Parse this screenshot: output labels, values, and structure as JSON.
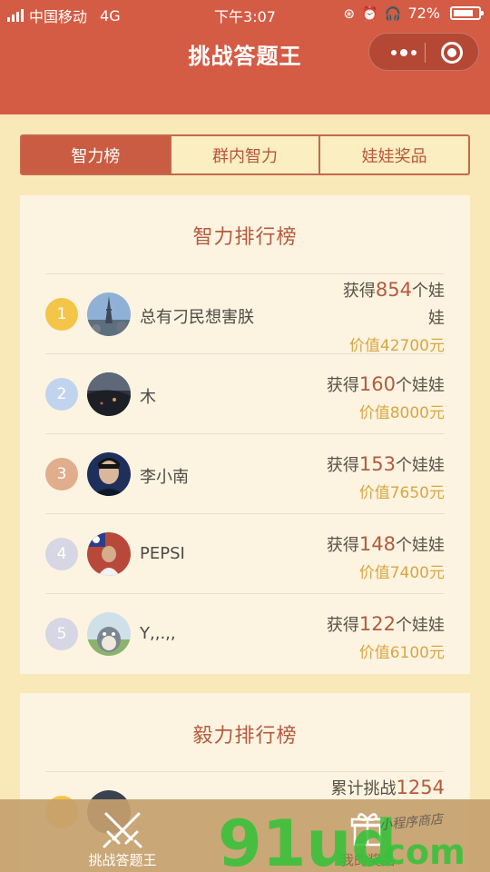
{
  "status_bar": {
    "carrier": "中国移动",
    "network": "4G",
    "time": "下午3:07",
    "battery": "72%"
  },
  "nav": {
    "title": "挑战答题王"
  },
  "tabs": [
    {
      "label": "智力榜",
      "active": true
    },
    {
      "label": "群内智力",
      "active": false
    },
    {
      "label": "娃娃奖品",
      "active": false
    }
  ],
  "leaderboard": {
    "title": "智力排行榜",
    "rows": [
      {
        "rank": "1",
        "name": "总有刁民想害朕",
        "prize_prefix": "获得",
        "count": "854",
        "prize_suffix_line1": "个娃",
        "prize_suffix_line2": "娃",
        "value": "价值42700元",
        "rank_color": "#f3c548"
      },
      {
        "rank": "2",
        "name": "木",
        "prize_prefix": "获得",
        "count": "160",
        "prize_suffix": "个娃娃",
        "value": "价值8000元",
        "rank_color": "#c2d3ee"
      },
      {
        "rank": "3",
        "name": "李小南",
        "prize_prefix": "获得",
        "count": "153",
        "prize_suffix": "个娃娃",
        "value": "价值7650元",
        "rank_color": "#e0ae8d"
      },
      {
        "rank": "4",
        "name": "PEPSI",
        "prize_prefix": "获得",
        "count": "148",
        "prize_suffix": "个娃娃",
        "value": "价值7400元",
        "rank_color": "#d6d6e4"
      },
      {
        "rank": "5",
        "name": "Y,,.,,",
        "prize_prefix": "获得",
        "count": "122",
        "prize_suffix": "个娃娃",
        "value": "价值6100元",
        "rank_color": "#d6d6e4"
      }
    ]
  },
  "perseverance": {
    "title": "毅力排行榜",
    "first_row": {
      "prize_prefix": "累计挑战",
      "count": "1254"
    }
  },
  "tabbar": {
    "items": [
      {
        "label": "挑战答题王",
        "icon": "crossed-swords-icon"
      },
      {
        "label": "我的奖品",
        "icon": "gift-icon"
      }
    ]
  },
  "watermark": {
    "brand": "91ud",
    "domain": ".com",
    "tagline": "小程序商店"
  }
}
